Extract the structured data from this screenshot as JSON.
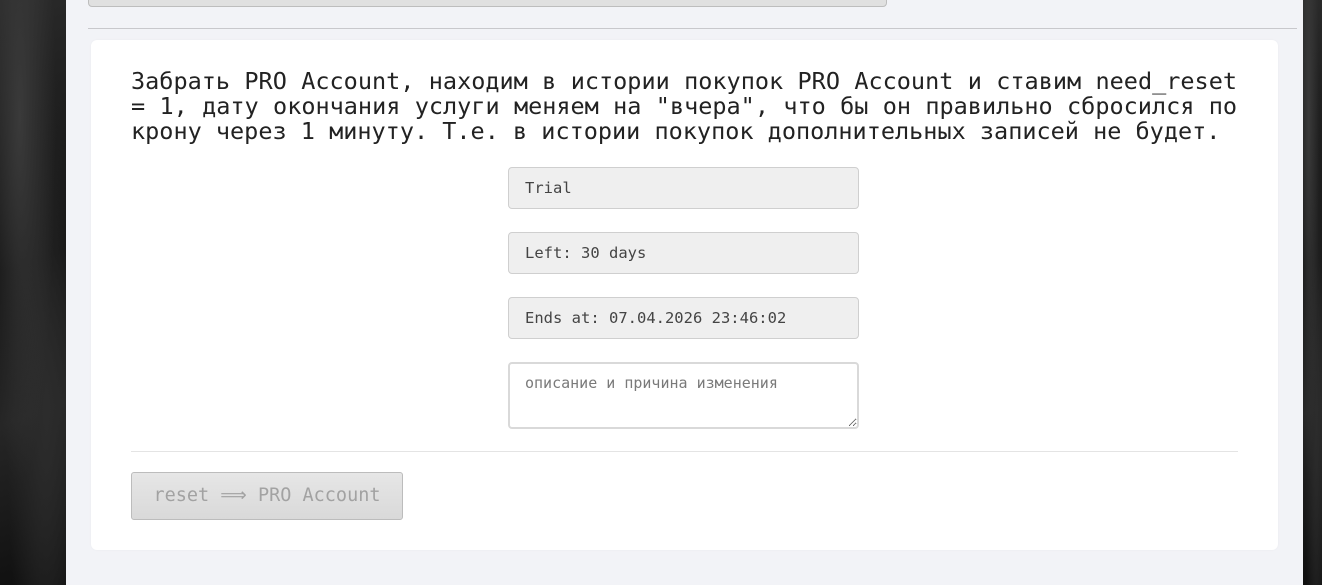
{
  "description": "Забрать PRO Account, находим в истории покупок PRO Account и ставим need_reset = 1, дату окончания услуги меняем на \"вчера\", что бы он правильно сбросился по крону через 1 минуту. Т.е. в истории покупок дополнительных записей не будет.",
  "fields": {
    "plan": "Trial",
    "left": "Left: 30 days",
    "ends_at": "Ends at: 07.04.2026 23:46:02"
  },
  "reason": {
    "value": "",
    "placeholder": "описание и причина изменения"
  },
  "reset_button": {
    "label": "reset ⟹ PRO Account",
    "disabled": true
  }
}
